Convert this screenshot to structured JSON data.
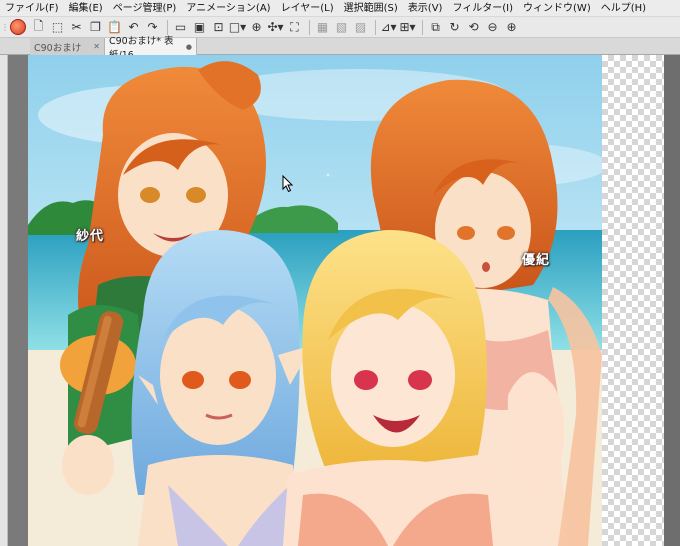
{
  "menu": {
    "items": [
      "ファイル(F)",
      "編集(E)",
      "ページ管理(P)",
      "アニメーション(A)",
      "レイヤー(L)",
      "選択範囲(S)",
      "表示(V)",
      "フィルター(I)",
      "ウィンドウ(W)",
      "ヘルプ(H)"
    ]
  },
  "toolbar": {
    "icons": [
      "new-page-icon",
      "selection-icon",
      "cut-icon",
      "copy-icon",
      "paste-icon",
      "undo-icon",
      "redo-icon"
    ]
  },
  "tabs": [
    {
      "label": "C90おまけ",
      "active": false
    },
    {
      "label": "C90おまけ* 表紙/16",
      "active": true
    }
  ],
  "artwork": {
    "labels": {
      "left": "紗代",
      "right": "優紀"
    }
  },
  "colors": {
    "sky": "#a9dcef",
    "sea": "#2cb8c7",
    "hair_orange": "#e0661e",
    "hair_blue": "#8bc6ea",
    "hair_blonde": "#f6cd4b"
  }
}
